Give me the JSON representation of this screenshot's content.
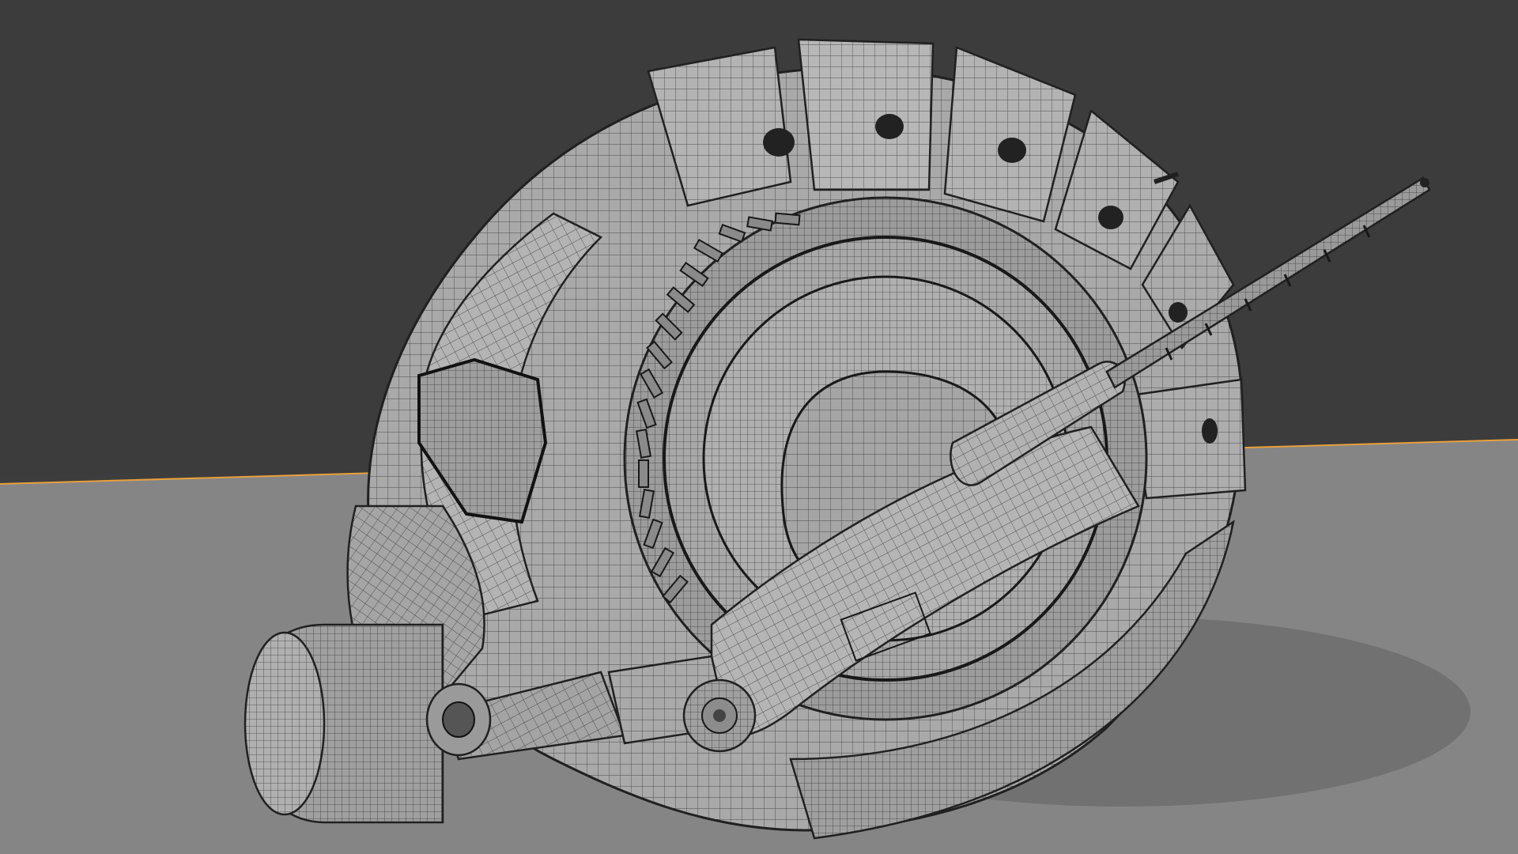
{
  "viewport": {
    "name": "3D Viewport",
    "display_mode": "wireframe-overlay"
  },
  "scene": {
    "object_name": "",
    "object_type": "helmet-mesh"
  },
  "colors": {
    "sky": "#3c3c3c",
    "floor": "#858585",
    "horizon_line": "#e8a03a",
    "shadow": "#6c6c6c",
    "mesh_light": "#b8b8b8",
    "mesh_mid": "#9a9a9a",
    "mesh_dark": "#6f6f6f",
    "wire": "#2a2a2a"
  }
}
